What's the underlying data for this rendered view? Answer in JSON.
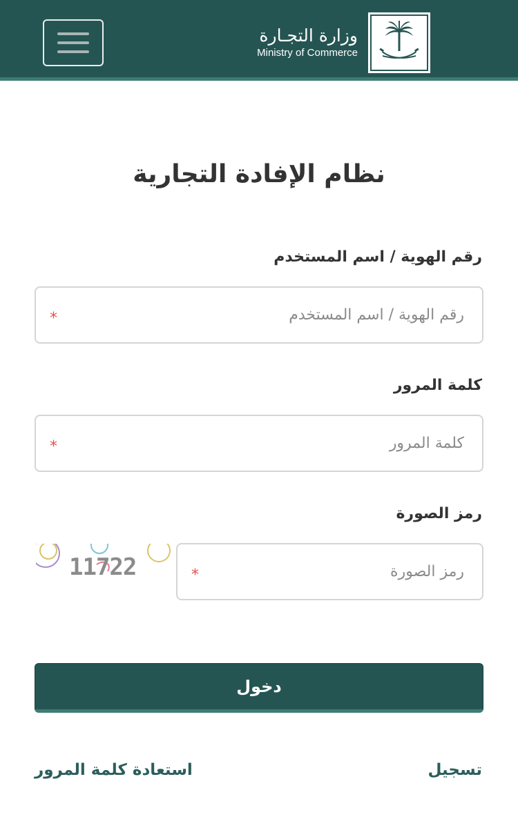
{
  "header": {
    "brand_ar": "وزارة التجـارة",
    "brand_en": "Ministry of Commerce",
    "menu_icon": "hamburger-menu-icon",
    "emblem_icon": "palm-and-swords-emblem-icon"
  },
  "title": "نظام الإفادة التجارية",
  "form": {
    "username": {
      "label": "رقم الهوية / اسم المستخدم",
      "placeholder": "رقم الهوية / اسم المستخدم",
      "value": "",
      "required_mark": "*"
    },
    "password": {
      "label": "كلمة المرور",
      "placeholder": "كلمة المرور",
      "value": "",
      "required_mark": "*"
    },
    "captcha": {
      "label": "رمز الصورة",
      "placeholder": "رمز الصورة",
      "value": "",
      "required_mark": "*",
      "image_text": "11722"
    },
    "login_label": "دخول"
  },
  "links": {
    "register": "تسجيل",
    "recover_password": "استعادة كلمة المرور"
  },
  "colors": {
    "header_bg": "#255553",
    "accent": "#3d7c74",
    "required": "#e2534e",
    "link": "#2a5e5b"
  }
}
